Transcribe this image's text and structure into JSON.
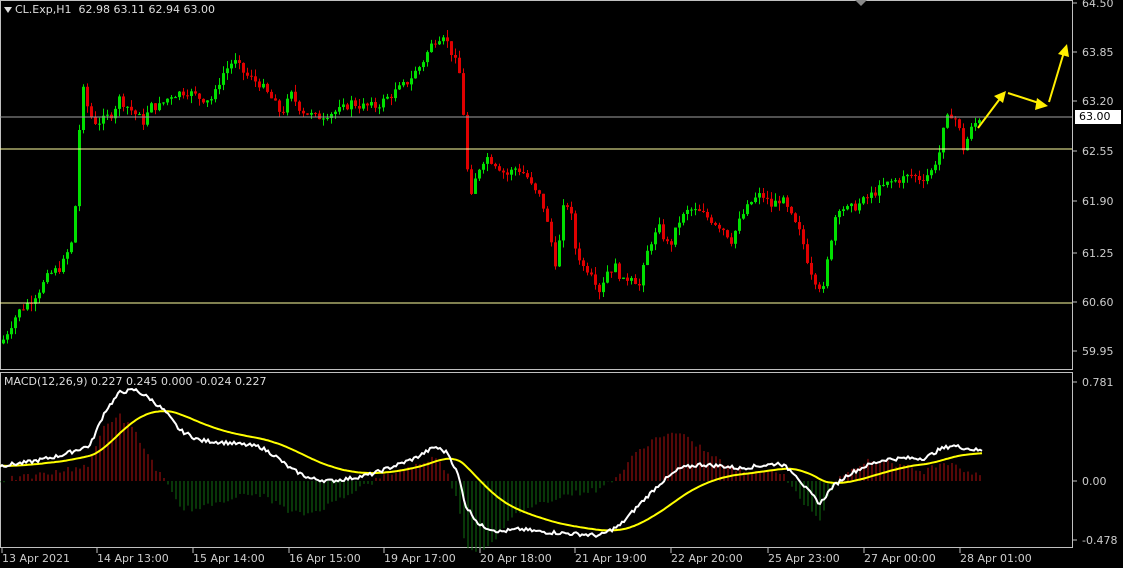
{
  "header": {
    "symbol": "CL.Exp,H1",
    "ohlc": "62.98 63.11 62.94 63.00"
  },
  "price_axis": {
    "ticks": [
      "64.50",
      "63.85",
      "63.20",
      "62.55",
      "61.90",
      "61.25",
      "60.60",
      "59.95"
    ],
    "current_label": "63.00"
  },
  "indicator": {
    "label": "MACD(12,26,9) 0.227 0.245 0.000 -0.024 0.227",
    "ticks": [
      "0.781",
      "0.00",
      "-0.478"
    ]
  },
  "time_axis": {
    "labels": [
      "13 Apr 2021",
      "14 Apr 13:00",
      "15 Apr 14:00",
      "16 Apr 15:00",
      "19 Apr 17:00",
      "20 Apr 18:00",
      "21 Apr 19:00",
      "22 Apr 20:00",
      "25 Apr 23:00",
      "27 Apr 00:00",
      "28 Apr 01:00"
    ]
  },
  "colors": {
    "bull": "#00e000",
    "bear": "#e00000",
    "macd_line": "#ffffff",
    "signal_line": "#ffff00",
    "level_line": "#ffffa0",
    "arrow": "#ffee00"
  },
  "chart_data": {
    "type": "candlestick",
    "levels": [
      62.55,
      60.6
    ],
    "current_price": 63.0,
    "ylim": [
      59.7,
      64.55
    ],
    "macd_ylim": [
      -0.55,
      0.85
    ]
  }
}
